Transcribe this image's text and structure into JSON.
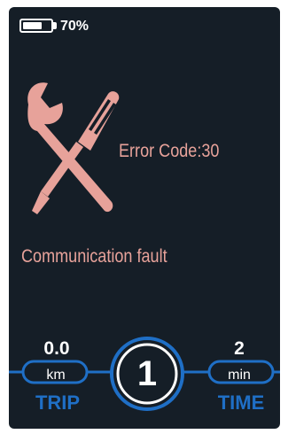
{
  "status": {
    "battery_percent_text": "70%",
    "battery_level": 0.7
  },
  "error": {
    "icon": "wrench-screwdriver-icon",
    "code_text": "Error Code:30",
    "message": "Communication  fault",
    "color": "#e7a29a"
  },
  "trip": {
    "value": "0.0",
    "unit": "km",
    "label": "TRIP"
  },
  "assist": {
    "level": "1"
  },
  "time": {
    "value": "2",
    "unit": "min",
    "label": "TIME"
  },
  "colors": {
    "background": "#151e27",
    "accent": "#1f6fc6",
    "text": "#ffffff"
  }
}
